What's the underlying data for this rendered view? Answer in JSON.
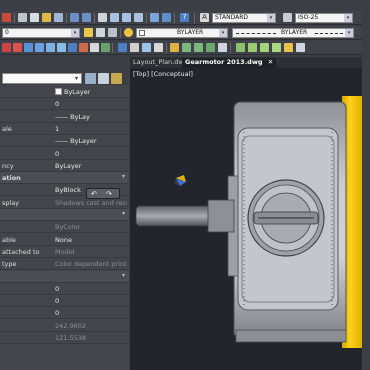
{
  "toolbar1": {
    "text_style": "STANDARD",
    "dim_style": "ISO-25"
  },
  "toolbar2": {
    "layer": "0",
    "color": "BYLAYER",
    "linetype": "BYLAYER"
  },
  "properties": {
    "rows": [
      {
        "key": "",
        "value": "ByLayer",
        "swatch": true
      },
      {
        "key": "",
        "value": "0"
      },
      {
        "key": "",
        "value": "—— ByLay"
      },
      {
        "key": "ale",
        "value": "1"
      },
      {
        "key": "",
        "value": "—— ByLayer"
      },
      {
        "key": "",
        "value": "0"
      },
      {
        "key": "ncy",
        "value": "ByLayer"
      },
      {
        "key": "ation",
        "value": "",
        "header": true
      },
      {
        "key": "",
        "value": "ByBlock"
      },
      {
        "key": "splay",
        "value": "Shadows cast and recei",
        "dim": true
      },
      {
        "key": "",
        "value": "",
        "header": true
      },
      {
        "key": "",
        "value": "ByColor",
        "dim": true
      },
      {
        "key": "able",
        "value": "None"
      },
      {
        "key": "attached to",
        "value": "Model",
        "dim": true
      },
      {
        "key": "type",
        "value": "Color dependent print st",
        "dim": true
      },
      {
        "key": "",
        "value": "",
        "header": true
      },
      {
        "key": "",
        "value": "0"
      },
      {
        "key": "",
        "value": "0"
      },
      {
        "key": "",
        "value": "0"
      },
      {
        "key": "",
        "value": "242.9602",
        "dim": true
      },
      {
        "key": "",
        "value": "121.5538",
        "dim": true
      }
    ]
  },
  "tabs": [
    {
      "label": "Layout_Plan.dwg",
      "active": false
    },
    {
      "label": "Gearmotor 2013.dwg",
      "active": true
    }
  ],
  "tab_close": "✕",
  "viewport_label": "[Top] [Conceptual]",
  "colors": {
    "accent_yellow": "#f2c400",
    "viewport_bg": "#22252b",
    "panel_bg": "#42464b"
  }
}
